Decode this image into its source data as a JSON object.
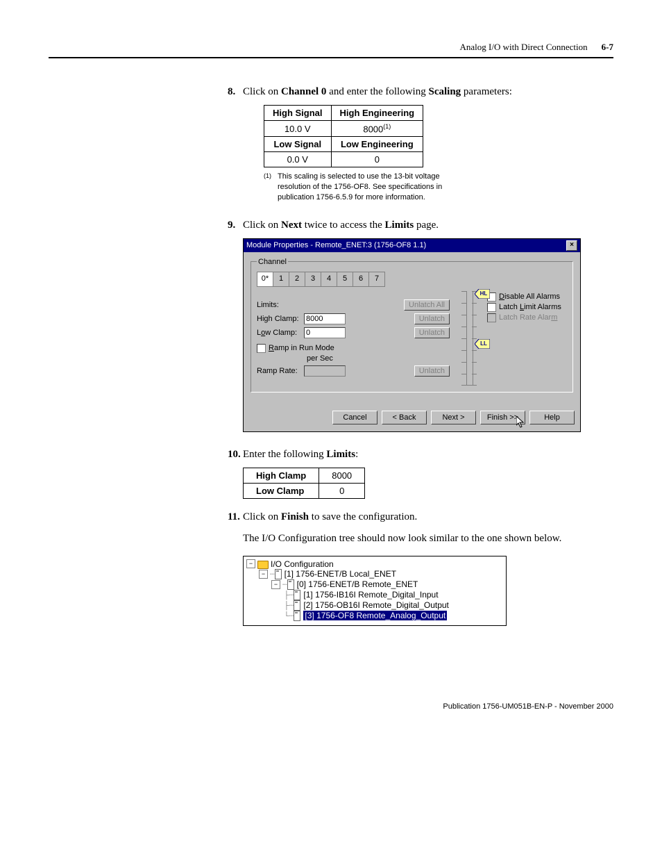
{
  "header": {
    "title": "Analog I/O with Direct Connection",
    "page": "6-7"
  },
  "step8": {
    "num": "8.",
    "pre": "Click on ",
    "bold1": "Channel 0",
    "mid": " and enter the following ",
    "bold2": "Scaling",
    "post": " parameters:"
  },
  "scaling_table": {
    "h1": "High Signal",
    "h2": "High Engineering",
    "r1c1": "10.0 V",
    "r1c2": "8000",
    "r1c2_sup": "(1)",
    "h3": "Low Signal",
    "h4": "Low Engineering",
    "r2c1": "0.0 V",
    "r2c2": "0"
  },
  "footnote": {
    "num": "(1)",
    "text": "This scaling is selected to use the 13-bit voltage resolution of the 1756-OF8. See specifications in publication 1756-6.5.9 for more information."
  },
  "step9": {
    "num": "9.",
    "pre": "Click on ",
    "bold1": "Next",
    "mid": " twice to access the ",
    "bold2": "Limits",
    "post": " page."
  },
  "dialog": {
    "title": "Module Properties - Remote_ENET:3 (1756-OF8 1.1)",
    "close": "×",
    "channel_legend": "Channel",
    "tabs": [
      "0*",
      "1",
      "2",
      "3",
      "4",
      "5",
      "6",
      "7"
    ],
    "limits_label": "Limits:",
    "high_clamp_label": "High Clamp:",
    "high_clamp_value": "8000",
    "low_clamp_label": "Low Clamp:",
    "low_clamp_value": "0",
    "unlatch_all": "Unlatch All",
    "unlatch": "Unlatch",
    "ramp_run": "Ramp in Run Mode",
    "per_sec": "per Sec",
    "ramp_rate_label": "Ramp Rate:",
    "hl_marker": "HL",
    "ll_marker": "LL",
    "disable_all": "Disable All Alarms",
    "latch_limit": "Latch Limit Alarms",
    "latch_rate": "Latch Rate Alarm",
    "cancel": "Cancel",
    "back": "< Back",
    "next": "Next >",
    "finish": "Finish >>",
    "help": "Help"
  },
  "step10": {
    "num": "10.",
    "pre": "Enter the following ",
    "bold1": "Limits",
    "post": ":"
  },
  "limits_table": {
    "h1": "High Clamp",
    "v1": "8000",
    "h2": "Low Clamp",
    "v2": "0"
  },
  "step11": {
    "num": "11.",
    "pre": "Click on ",
    "bold1": "Finish",
    "post": " to save the configuration."
  },
  "tree_intro": "The I/O Configuration tree should now look similar to the one shown below.",
  "tree": {
    "root": "I/O Configuration",
    "n1": "[1] 1756-ENET/B Local_ENET",
    "n2": "[0] 1756-ENET/B Remote_ENET",
    "n3": "[1] 1756-IB16I Remote_Digital_Input",
    "n4": "[2] 1756-OB16I Remote_Digital_Output",
    "n5": "[3] 1756-OF8 Remote_Analog_Output"
  },
  "footer": "Publication 1756-UM051B-EN-P - November 2000"
}
